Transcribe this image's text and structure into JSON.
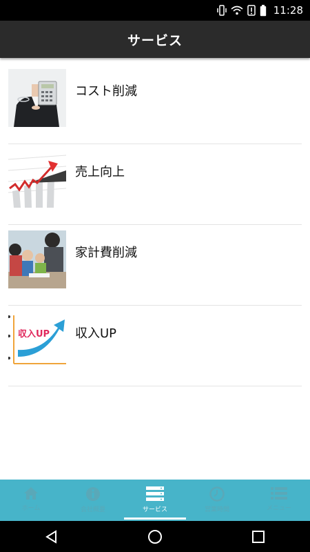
{
  "status_bar": {
    "time": "11:28",
    "icons": [
      "vibrate-icon",
      "wifi-icon",
      "alert-icon",
      "battery-icon"
    ]
  },
  "app_bar": {
    "title": "サービス"
  },
  "services": [
    {
      "label": "コスト削減",
      "image": "businesswoman-calculator"
    },
    {
      "label": "売上向上",
      "image": "rising-graph-arrow"
    },
    {
      "label": "家計費削減",
      "image": "family-photo"
    },
    {
      "label": "収入UP",
      "image": "income-up-arrow",
      "image_text": "収入UP"
    }
  ],
  "tabs": [
    {
      "label": "ホーム",
      "icon": "home-icon",
      "active": false
    },
    {
      "label": "会社概要",
      "icon": "info-icon",
      "active": false
    },
    {
      "label": "サービス",
      "icon": "services-icon",
      "active": true
    },
    {
      "label": "営業時間",
      "icon": "clock-icon",
      "active": false
    },
    {
      "label": "メニュー",
      "icon": "menu-icon",
      "active": false
    }
  ],
  "colors": {
    "app_bar": "#2b2b2b",
    "tab_bar": "#47b4c9",
    "tab_inactive": "#5aa8b8",
    "tab_active": "#ffffff"
  }
}
